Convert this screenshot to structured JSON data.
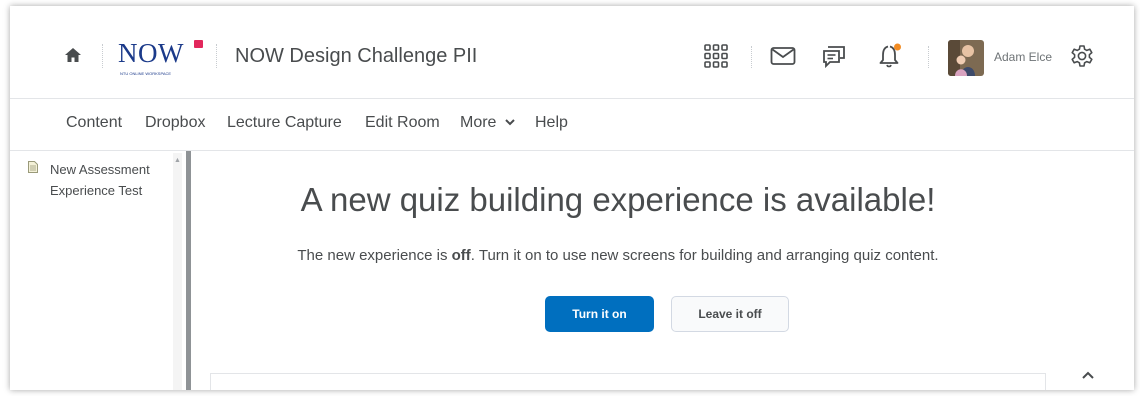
{
  "header": {
    "logo_text": "NOW",
    "logo_tagline": "NTU ONLINE WORKSPACE",
    "course_title": "NOW Design Challenge PII",
    "user_name": "Adam Elce",
    "notification_dot_color": "#f28b22",
    "icons": [
      "home-icon",
      "waffle-grid-icon",
      "mail-icon",
      "chat-icon",
      "bell-icon",
      "avatar",
      "gear-icon"
    ]
  },
  "nav": {
    "items": [
      {
        "label": "Content"
      },
      {
        "label": "Dropbox"
      },
      {
        "label": "Lecture Capture"
      },
      {
        "label": "Edit Room"
      },
      {
        "label": "More"
      },
      {
        "label": "Help"
      }
    ]
  },
  "tree": {
    "items": [
      {
        "label": "New Assessment Experience Test"
      }
    ]
  },
  "main": {
    "headline": "A new quiz building experience is available!",
    "subline_prefix": "The new experience is ",
    "subline_bold": "off",
    "subline_suffix": ". Turn it on to use new screens for building and arranging quiz content.",
    "primary_button": "Turn it on",
    "secondary_button": "Leave it off"
  },
  "colors": {
    "primary": "#006fbf",
    "text": "#494c4e",
    "logo_blue": "#1b3a8a",
    "logo_flag": "#e2275c"
  }
}
